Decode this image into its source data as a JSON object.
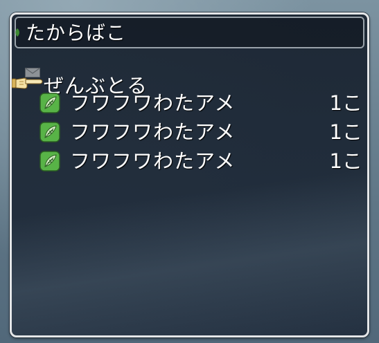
{
  "window": {
    "title": "たからばこ"
  },
  "menu": {
    "take_all_label": "ぜんぶとる"
  },
  "items": [
    {
      "name": "フワフワわたアメ",
      "count": "1こ",
      "icon": "green-leaf-icon"
    },
    {
      "name": "フワフワわたアメ",
      "count": "1こ",
      "icon": "green-leaf-icon"
    },
    {
      "name": "フワフワわたアメ",
      "count": "1こ",
      "icon": "green-leaf-icon"
    }
  ],
  "colors": {
    "window_border": "#e4e6e8",
    "window_bg": "#1b2636",
    "text": "#ffffff",
    "item_icon_green": "#58b347"
  },
  "icons": {
    "mail": "envelope-icon",
    "cursor": "pointing-hand-cursor-icon",
    "title_leaf": "leaf-icon"
  }
}
